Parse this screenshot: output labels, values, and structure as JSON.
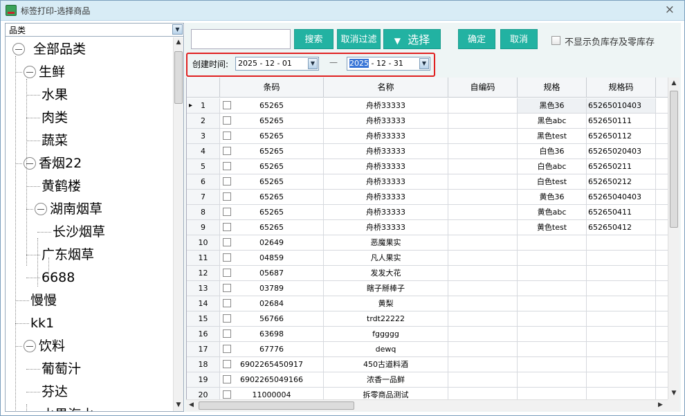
{
  "window": {
    "title": "标签打印-选择商品",
    "close_glyph": "×"
  },
  "category_select": {
    "value": "品类"
  },
  "tree": [
    {
      "label": "全部品类",
      "level": 0,
      "toggle": true
    },
    {
      "label": "生鲜",
      "level": 1,
      "toggle": true
    },
    {
      "label": "水果",
      "level": 2,
      "toggle": false
    },
    {
      "label": "肉类",
      "level": 2,
      "toggle": false
    },
    {
      "label": "蔬菜",
      "level": 2,
      "toggle": false
    },
    {
      "label": "香烟22",
      "level": 1,
      "toggle": true
    },
    {
      "label": "黄鹤楼",
      "level": 2,
      "toggle": false
    },
    {
      "label": "湖南烟草",
      "level": 2,
      "toggle": true
    },
    {
      "label": "长沙烟草",
      "level": 3,
      "toggle": false
    },
    {
      "label": "广东烟草",
      "level": 2,
      "toggle": false
    },
    {
      "label": "6688",
      "level": 2,
      "toggle": false
    },
    {
      "label": "慢慢",
      "level": 1,
      "toggle": false
    },
    {
      "label": "kk1",
      "level": 1,
      "toggle": false
    },
    {
      "label": "饮料",
      "level": 1,
      "toggle": true
    },
    {
      "label": "葡萄汁",
      "level": 2,
      "toggle": false
    },
    {
      "label": "芬达",
      "level": 2,
      "toggle": false
    },
    {
      "label": "水果汽水",
      "level": 2,
      "toggle": false
    }
  ],
  "toolbar": {
    "search_placeholder": "",
    "search_label": "搜索",
    "clear_filter_label": "取消过滤",
    "select_label": "选择",
    "confirm_label": "确定",
    "cancel_label": "取消",
    "hide_stock_label": "不显示负库存及零库存"
  },
  "date_filter": {
    "label": "创建时间:",
    "start": "2025 - 12 - 01",
    "separator": "—",
    "end_year": "2025",
    "end_rest": " - 12 - 31"
  },
  "grid": {
    "columns": [
      "条码",
      "名称",
      "自编码",
      "规格",
      "规格码"
    ],
    "rows": [
      {
        "n": "1",
        "barcode": "65265",
        "name": "舟桥33333",
        "code": "",
        "spec": "黑色36",
        "spec_code": "65265010403"
      },
      {
        "n": "2",
        "barcode": "65265",
        "name": "舟桥33333",
        "code": "",
        "spec": "黑色abc",
        "spec_code": "652650111"
      },
      {
        "n": "3",
        "barcode": "65265",
        "name": "舟桥33333",
        "code": "",
        "spec": "黑色test",
        "spec_code": "652650112"
      },
      {
        "n": "4",
        "barcode": "65265",
        "name": "舟桥33333",
        "code": "",
        "spec": "白色36",
        "spec_code": "65265020403"
      },
      {
        "n": "5",
        "barcode": "65265",
        "name": "舟桥33333",
        "code": "",
        "spec": "白色abc",
        "spec_code": "652650211"
      },
      {
        "n": "6",
        "barcode": "65265",
        "name": "舟桥33333",
        "code": "",
        "spec": "白色test",
        "spec_code": "652650212"
      },
      {
        "n": "7",
        "barcode": "65265",
        "name": "舟桥33333",
        "code": "",
        "spec": "黄色36",
        "spec_code": "65265040403"
      },
      {
        "n": "8",
        "barcode": "65265",
        "name": "舟桥33333",
        "code": "",
        "spec": "黄色abc",
        "spec_code": "652650411"
      },
      {
        "n": "9",
        "barcode": "65265",
        "name": "舟桥33333",
        "code": "",
        "spec": "黄色test",
        "spec_code": "652650412"
      },
      {
        "n": "10",
        "barcode": "02649",
        "name": "恶魔果实",
        "code": "",
        "spec": "",
        "spec_code": ""
      },
      {
        "n": "11",
        "barcode": "04859",
        "name": "凡人果实",
        "code": "",
        "spec": "",
        "spec_code": ""
      },
      {
        "n": "12",
        "barcode": "05687",
        "name": "发发大花",
        "code": "",
        "spec": "",
        "spec_code": ""
      },
      {
        "n": "13",
        "barcode": "03789",
        "name": "瞎子掰棒子",
        "code": "",
        "spec": "",
        "spec_code": ""
      },
      {
        "n": "14",
        "barcode": "02684",
        "name": "黄梨",
        "code": "",
        "spec": "",
        "spec_code": ""
      },
      {
        "n": "15",
        "barcode": "56766",
        "name": "trdt22222",
        "code": "",
        "spec": "",
        "spec_code": ""
      },
      {
        "n": "16",
        "barcode": "63698",
        "name": "fggggg",
        "code": "",
        "spec": "",
        "spec_code": ""
      },
      {
        "n": "17",
        "barcode": "67776",
        "name": "dewq",
        "code": "",
        "spec": "",
        "spec_code": ""
      },
      {
        "n": "18",
        "barcode": "6902265450917",
        "name": "450古道料酒",
        "code": "",
        "spec": "",
        "spec_code": ""
      },
      {
        "n": "19",
        "barcode": "6902265049166",
        "name": "浓香一品鲜",
        "code": "",
        "spec": "",
        "spec_code": ""
      },
      {
        "n": "20",
        "barcode": "11000004",
        "name": "拆零商品测试",
        "code": "",
        "spec": "",
        "spec_code": ""
      }
    ]
  }
}
